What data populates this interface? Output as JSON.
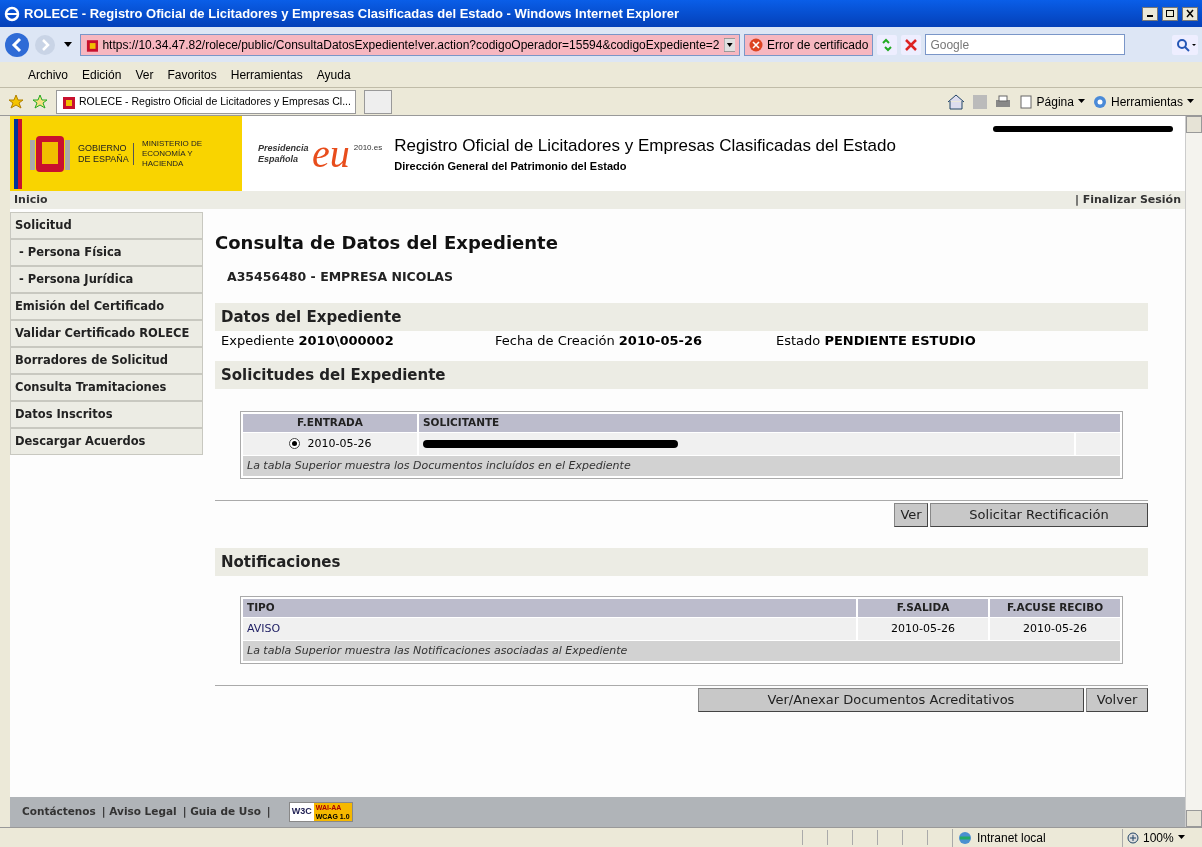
{
  "window": {
    "title": "ROLECE - Registro Oficial de Licitadores y Empresas Clasificadas del Estado - Windows Internet Explorer"
  },
  "address_bar": {
    "url": "https://10.34.47.82/rolece/public/ConsultaDatosExpediente!ver.action?codigoOperador=15594&codigoExpediente=2",
    "cert_error": "Error de certificado",
    "search_placeholder": "Google"
  },
  "menu": [
    "Archivo",
    "Edición",
    "Ver",
    "Favoritos",
    "Herramientas",
    "Ayuda"
  ],
  "favorites_bar": {
    "tab_title": "ROLECE - Registro Oficial de Licitadores y Empresas Cl...",
    "tools": [
      "Página",
      "Herramientas"
    ]
  },
  "header": {
    "gov": "GOBIERNO DE ESPAÑA",
    "ministry": "MINISTERIO DE ECONOMÍA Y HACIENDA",
    "presidency": "Presidencia Española",
    "eu_logo": "eu",
    "eu_year": "2010.es",
    "site_title": "Registro Oficial de Licitadores y Empresas Clasificadas del Estado",
    "site_subtitle": "Dirección General del Patrimonio del Estado"
  },
  "nav": {
    "home": "Inicio",
    "logout": "| Finalizar Sesión"
  },
  "sidebar": [
    {
      "label": "Solicitud",
      "kind": "section"
    },
    {
      "label": "- Persona Física",
      "kind": "sub"
    },
    {
      "label": "- Persona Jurídica",
      "kind": "sub"
    },
    {
      "label": "Emisión del Certificado",
      "kind": "section"
    },
    {
      "label": "Validar Certificado ROLECE",
      "kind": "section"
    },
    {
      "label": "Borradores de Solicitud",
      "kind": "section"
    },
    {
      "label": "Consulta Tramitaciones",
      "kind": "section"
    },
    {
      "label": "Datos Inscritos",
      "kind": "section"
    },
    {
      "label": "Descargar Acuerdos",
      "kind": "section"
    }
  ],
  "page_title": "Consulta de Datos del Expediente",
  "company": "A35456480 - EMPRESA NICOLAS",
  "datos": {
    "heading": "Datos del Expediente",
    "fields": [
      {
        "label": "Expediente",
        "value": "2010\\000002"
      },
      {
        "label": "Fecha de Creación",
        "value": "2010-05-26"
      },
      {
        "label": "Estado",
        "value": "PENDIENTE ESTUDIO"
      }
    ]
  },
  "solicitudes": {
    "heading": "Solicitudes del Expediente",
    "columns": [
      "F.ENTRADA",
      "SOLICITANTE"
    ],
    "rows": [
      {
        "selected": true,
        "f_entrada": "2010-05-26"
      }
    ],
    "caption": "La tabla Superior muestra los Documentos incluídos en el Expediente",
    "buttons": [
      "Ver",
      "Solicitar Rectificación"
    ]
  },
  "notificaciones": {
    "heading": "Notificaciones",
    "columns": [
      "TIPO",
      "F.SALIDA",
      "F.ACUSE RECIBO"
    ],
    "rows": [
      [
        "AVISO",
        "2010-05-26",
        "2010-05-26"
      ]
    ],
    "caption": "La tabla Superior muestra las Notificaciones asociadas al Expediente",
    "buttons": [
      "Ver/Anexar Documentos Acreditativos",
      "Volver"
    ]
  },
  "footer": {
    "links": [
      "Contáctenos",
      "| Aviso Legal",
      "| Guia de Uso",
      "|"
    ],
    "badge": {
      "w3c": "W3C",
      "level": "WAI-AA",
      "version": "WCAG 1.0"
    }
  },
  "status_bar": {
    "zone": "Intranet local",
    "zoom": "100%"
  }
}
